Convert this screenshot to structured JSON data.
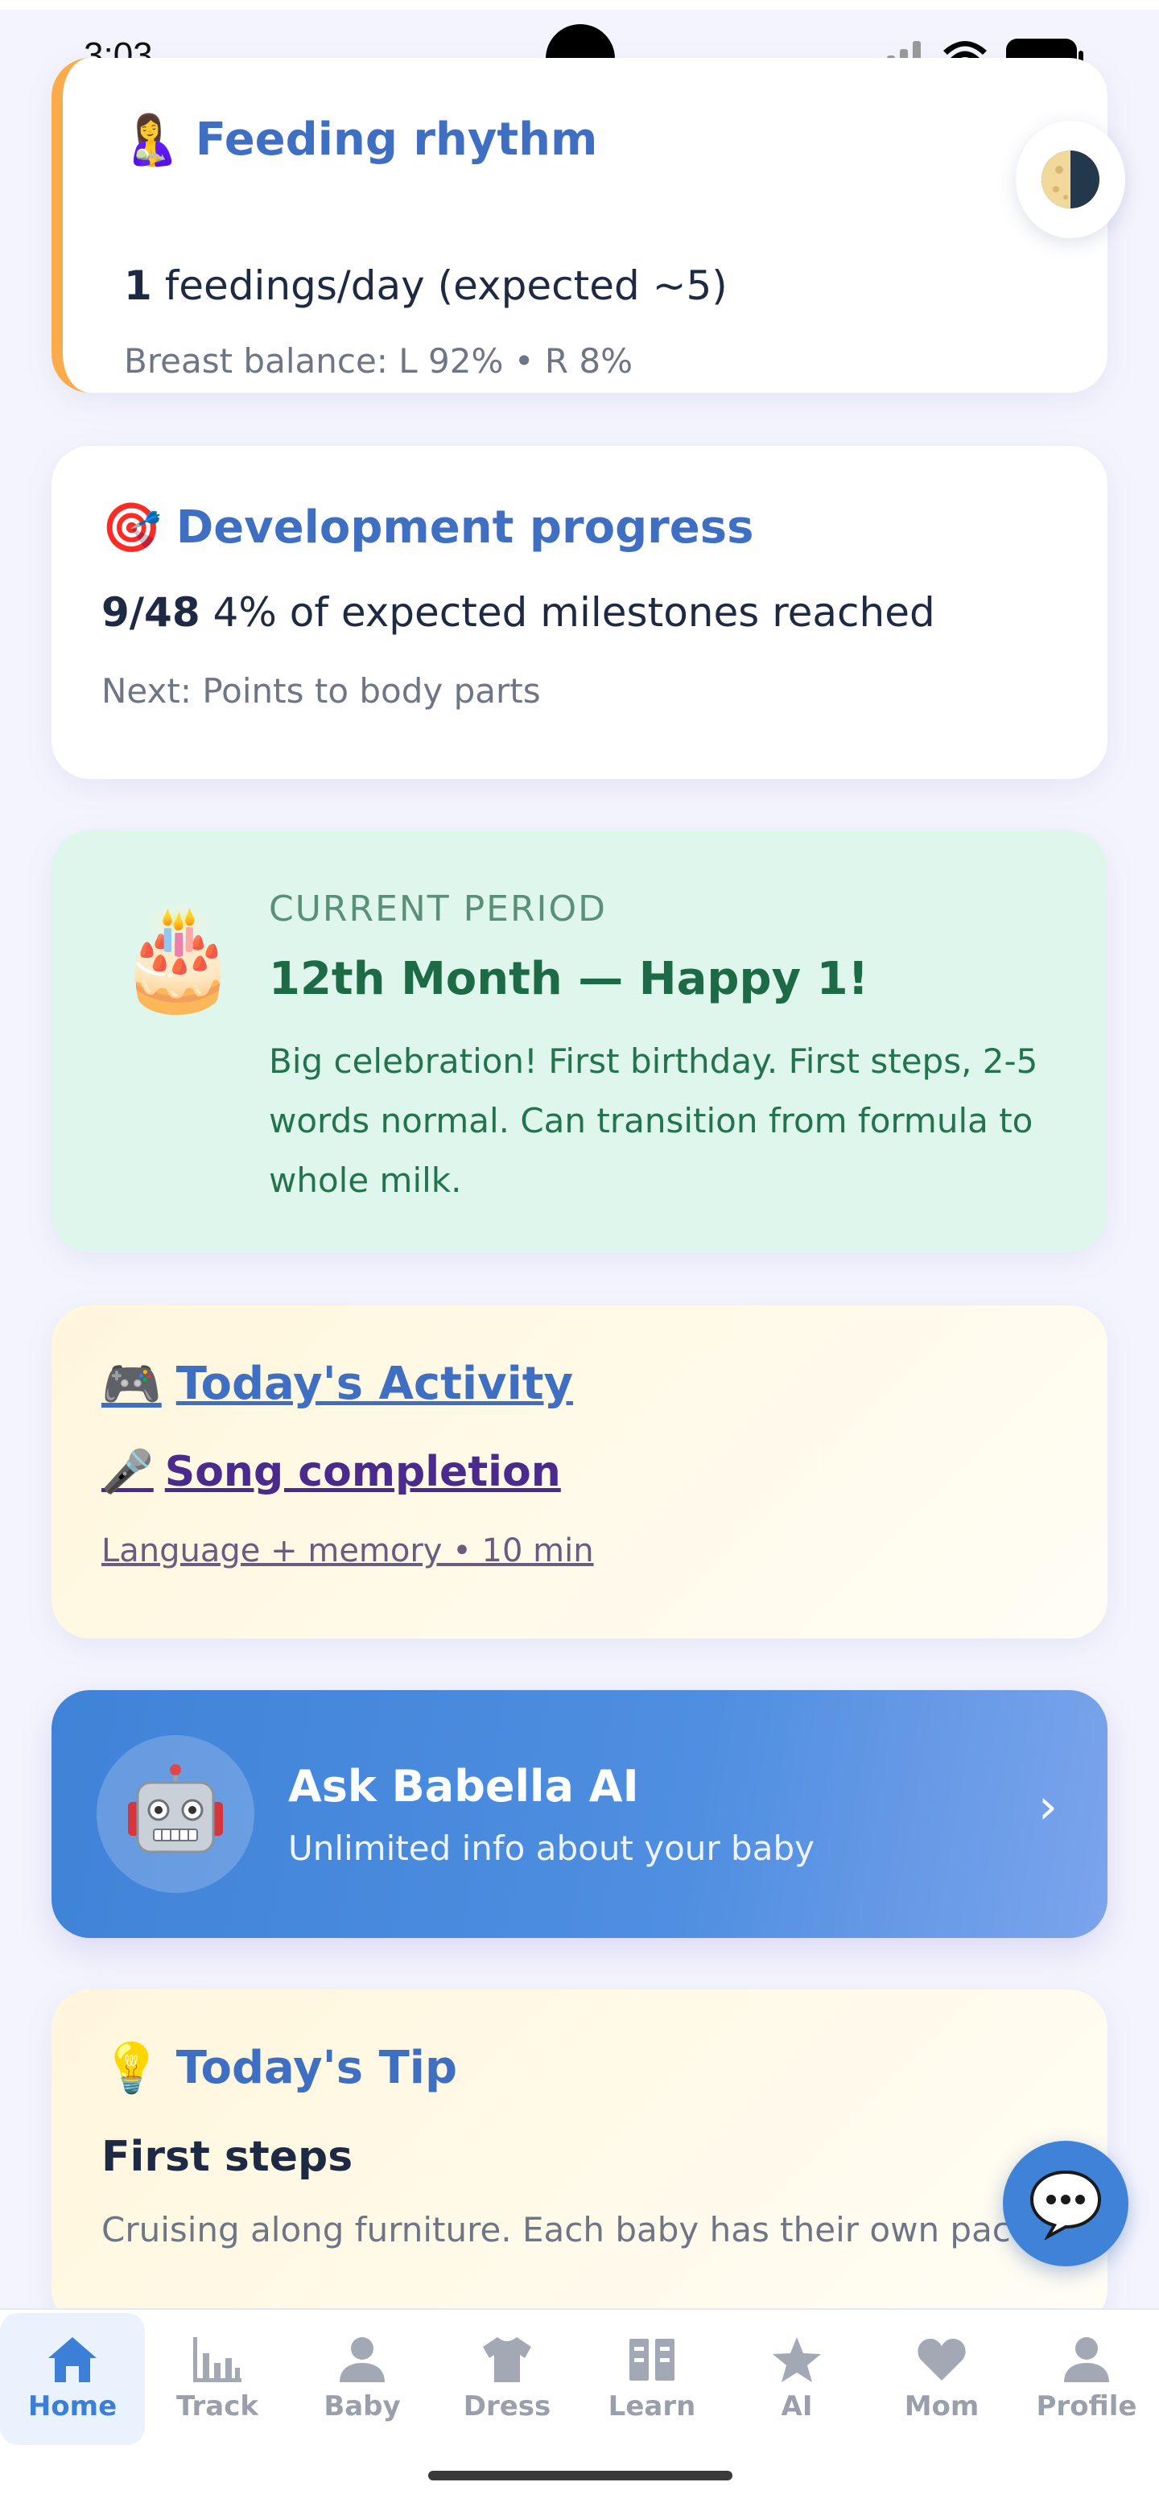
{
  "status": {
    "time": "3:03"
  },
  "feeding": {
    "emoji": "🤱",
    "title": "Feeding rhythm",
    "count": "1",
    "count_suffix": " feedings/day (expected ~5)",
    "balance": "Breast balance: L 92% • R 8%"
  },
  "development": {
    "emoji": "🎯",
    "title": "Development progress",
    "fraction": "9/48",
    "summary": " 4% of expected milestones reached",
    "next": "Next: Points to body parts"
  },
  "period": {
    "emoji": "🎂",
    "label": "CURRENT PERIOD",
    "title": "12th Month — Happy 1!",
    "description": "Big celebration! First birthday. First steps, 2-5 words normal. Can transition from formula to whole milk."
  },
  "activity": {
    "emoji": "🎮",
    "title": "Today's Activity",
    "name_emoji": "🎤",
    "name": "Song completion",
    "meta": "Language + memory • 10 min"
  },
  "ai_banner": {
    "title": "Ask Babella AI",
    "subtitle": "Unlimited info about your baby",
    "chevron": "›"
  },
  "tip": {
    "emoji": "💡",
    "title": "Today's Tip",
    "headline": "First steps",
    "text": "Cruising along furniture. Each baby has their own pace."
  },
  "nav": {
    "items": [
      {
        "label": "Home",
        "icon": "home-icon",
        "active": true
      },
      {
        "label": "Track",
        "icon": "chart-icon"
      },
      {
        "label": "Baby",
        "icon": "person-icon"
      },
      {
        "label": "Dress",
        "icon": "shirt-icon"
      },
      {
        "label": "Learn",
        "icon": "book-icon"
      },
      {
        "label": "AI",
        "icon": "star-icon"
      },
      {
        "label": "Mom",
        "icon": "heart-icon"
      },
      {
        "label": "Profile",
        "icon": "profile-icon"
      }
    ]
  },
  "colors": {
    "accent": "#3f6fc2",
    "primary_blue": "#3f83d8",
    "feeding_accent": "#fbab4a",
    "period_bg": "#def6eb",
    "period_text": "#1d6a47"
  }
}
